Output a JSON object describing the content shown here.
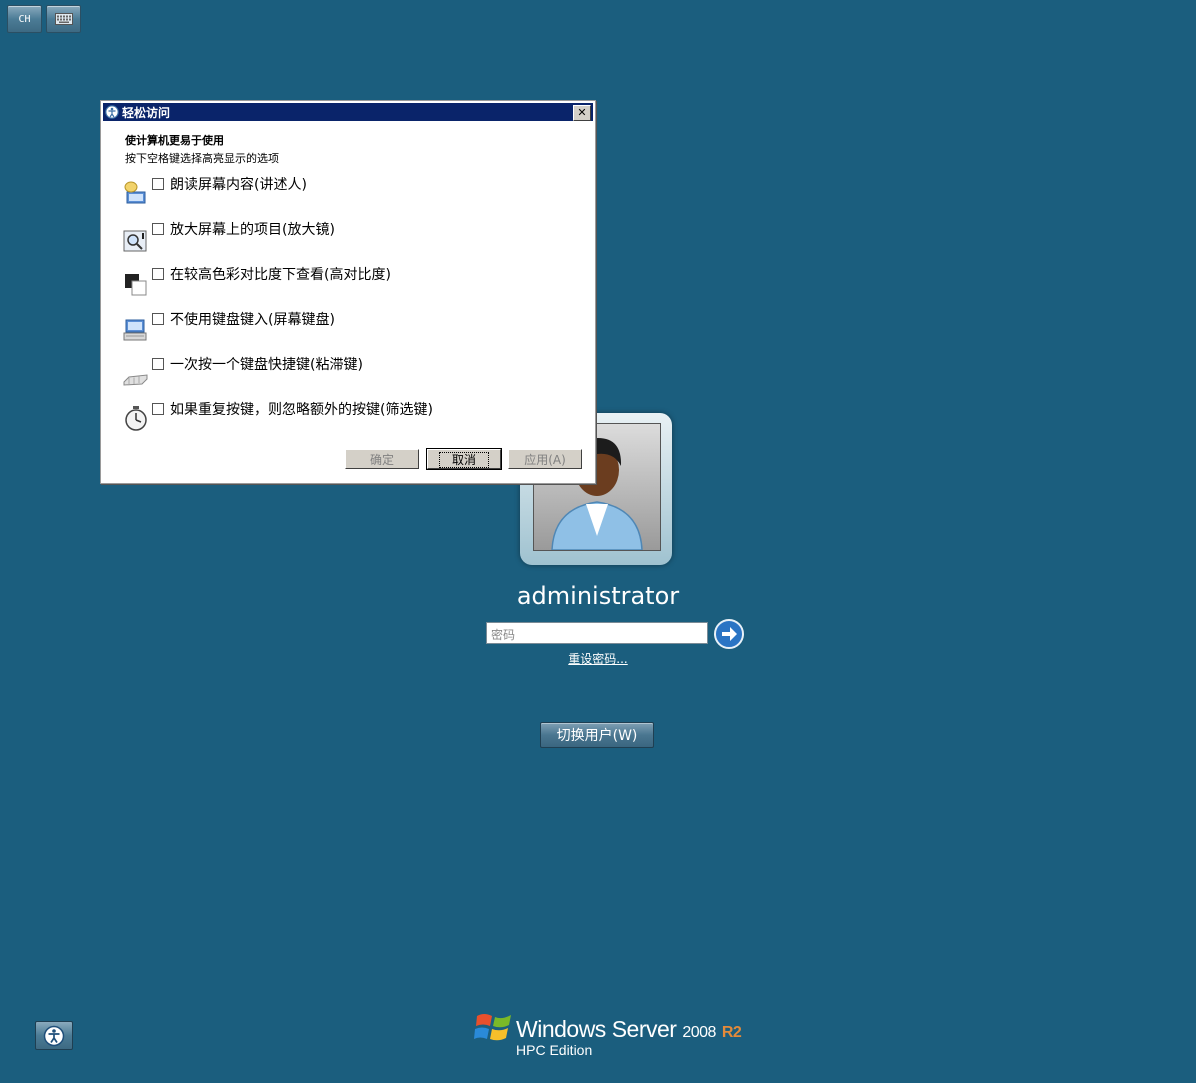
{
  "topbar": {
    "lang_label": "CH",
    "keyboard_icon": "keyboard-icon"
  },
  "dialog": {
    "title": "轻松访问",
    "heading": "使计算机更易于使用",
    "subheading": "按下空格键选择高亮显示的选项",
    "options": [
      {
        "label": "朗读屏幕内容(讲述人)",
        "icon": "narrator-icon",
        "checked": false
      },
      {
        "label": "放大屏幕上的项目(放大镜)",
        "icon": "magnifier-icon",
        "checked": false
      },
      {
        "label": "在较高色彩对比度下查看(高对比度)",
        "icon": "high-contrast-icon",
        "checked": false
      },
      {
        "label": "不使用键盘键入(屏幕键盘)",
        "icon": "onscreen-keyboard-icon",
        "checked": false
      },
      {
        "label": "一次按一个键盘快捷键(粘滞键)",
        "icon": "sticky-keys-icon",
        "checked": false
      },
      {
        "label": "如果重复按键，则忽略额外的按键(筛选键)",
        "icon": "filter-keys-icon",
        "checked": false
      }
    ],
    "buttons": {
      "ok": "确定",
      "cancel": "取消",
      "apply": "应用(A)"
    }
  },
  "login": {
    "username": "administrator",
    "password_placeholder": "密码",
    "reset_link": "重设密码...",
    "switch_user": "切换用户(W)"
  },
  "branding": {
    "product": "Windows Server",
    "version": "2008",
    "release": "R2",
    "edition": "HPC Edition"
  },
  "colors": {
    "background": "#1b5e7e",
    "titlebar": "#0a246a",
    "accent_r2": "#e38a3a"
  }
}
